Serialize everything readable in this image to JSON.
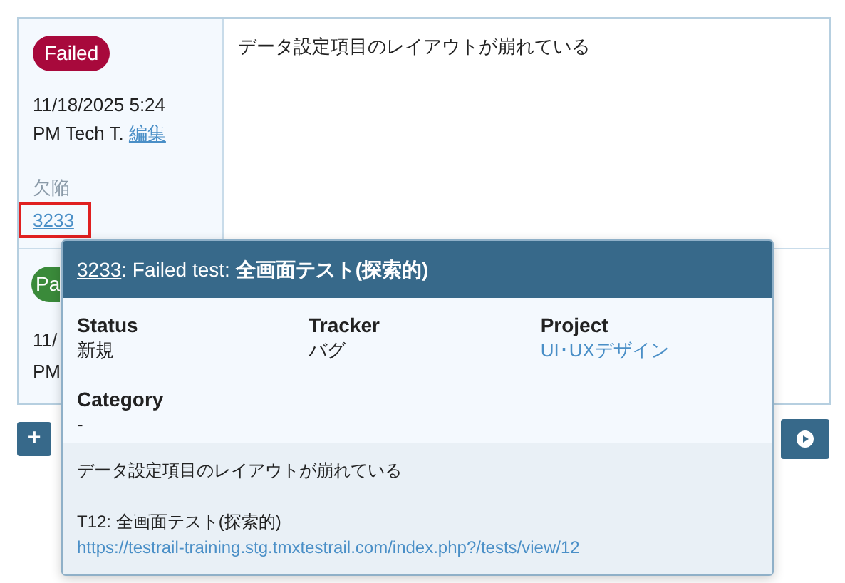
{
  "results": [
    {
      "status": {
        "label": "Failed",
        "kind": "failed"
      },
      "meta": "11/18/2025 5:24 PM Tech T.",
      "edit_link": "編集",
      "defects_label": "欠陥",
      "defect_link": "3233",
      "highlighted": true,
      "comment": "データ設定項目のレイアウトが崩れている"
    },
    {
      "status": {
        "label": "Pa",
        "kind": "passed"
      },
      "meta_lines": [
        "11/",
        "PM"
      ]
    }
  ],
  "toolbar": {
    "add_button": "+"
  },
  "popup": {
    "id_link": "3233",
    "title_prefix": ": Failed test: ",
    "title": "全画面テスト(探索的)",
    "fields": [
      {
        "label": "Status",
        "value": "新規",
        "kind": "text"
      },
      {
        "label": "Tracker",
        "value": "バグ",
        "kind": "text"
      },
      {
        "label": "Project",
        "value": "UI･UXデザイン",
        "kind": "link"
      },
      {
        "label": "Category",
        "value": "-",
        "kind": "text"
      }
    ],
    "description": "データ設定項目のレイアウトが崩れている",
    "test_title": "T12: 全画面テスト(探索的)",
    "test_url": "https://testrail-training.stg.tmxtestrail.com/index.php?/tests/view/12"
  }
}
